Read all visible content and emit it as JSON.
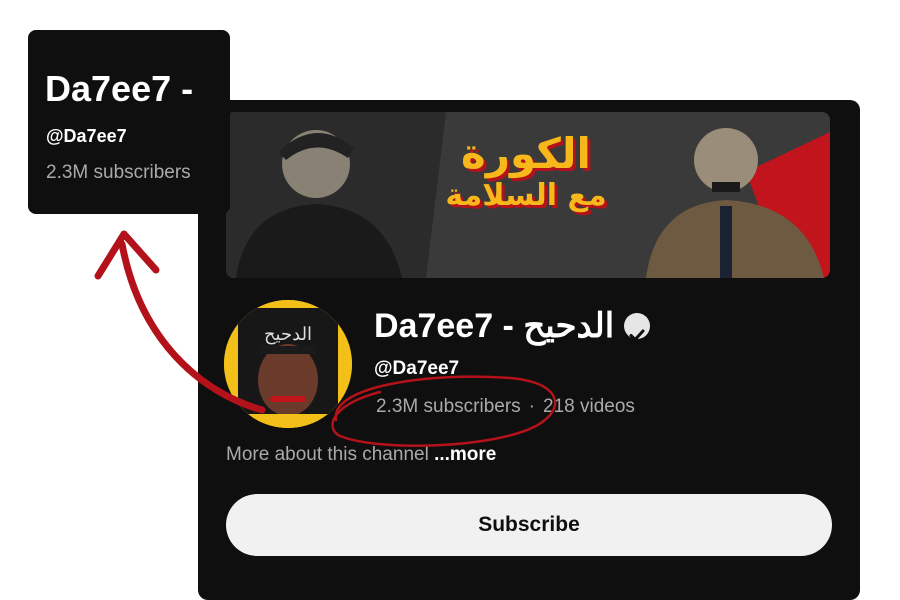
{
  "inset": {
    "channel_name": "Da7ee7 -",
    "handle": "@Da7ee7",
    "subscribers": "2.3M subscribers"
  },
  "channel": {
    "banner_title_line1": "الكورة",
    "banner_title_line2": "مع السلامة",
    "avatar_label": "الدحيح",
    "name": "Da7ee7 - الدحيح",
    "handle": "@Da7ee7",
    "subscribers": "2.3M subscribers",
    "separator": "·",
    "videos": "218 videos",
    "more_about": "More about this channel ",
    "more_link": "...more",
    "subscribe_label": "Subscribe"
  },
  "colors": {
    "card_bg": "#0f0f0f",
    "banner_accent": "#f6b81a",
    "annotation_red": "#b3121b",
    "subscribe_bg": "#f1f1f1"
  },
  "icons": [
    "verified-badge-icon",
    "annotation-arrow-icon",
    "annotation-circle-icon"
  ]
}
